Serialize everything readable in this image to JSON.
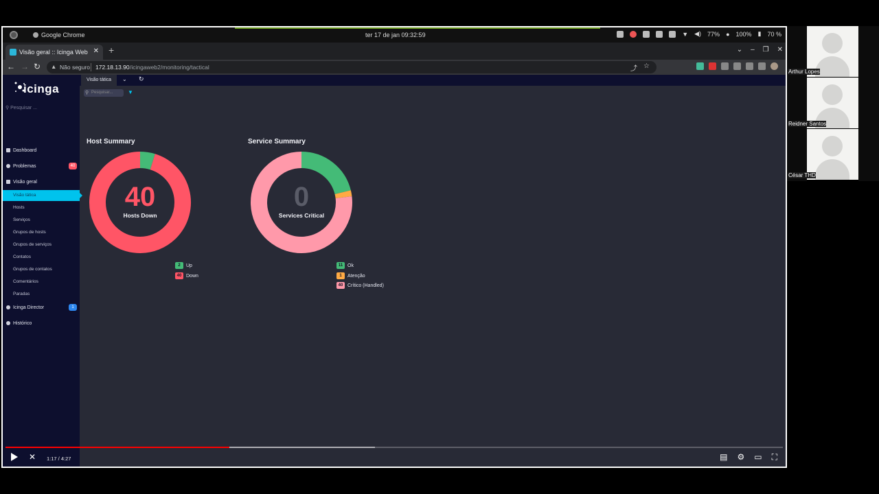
{
  "os_bar": {
    "app_name": "Google Chrome",
    "clock": "ter 17 de jan  09:32:59",
    "wifi": "77%",
    "battery": "100%",
    "extra": "70 %"
  },
  "browser": {
    "tab_title": "Visão geral :: Icinga Web",
    "security_label": "Não seguro",
    "url_host": "172.18.13.90",
    "url_path": "/icingaweb2/monitoring/tactical",
    "hover_url": "172.18.13.90/icingaweb2/monitoring/tactical"
  },
  "icinga": {
    "logo": "icinga",
    "search_placeholder": "Pesquisar ...",
    "nav": {
      "dashboard": "Dashboard",
      "problems": "Problemas",
      "problems_badge": "40",
      "overview": "Visão geral",
      "sub": [
        "Visão tática",
        "Hosts",
        "Serviços",
        "Grupos de hosts",
        "Grupos de serviços",
        "Contatos",
        "Grupos de contatos",
        "Comentários",
        "Paradas"
      ],
      "director": "Icinga Director",
      "director_badge": "1",
      "history": "Histórico"
    },
    "content_tab": "Visão tática",
    "filter_placeholder": "Pesquisar...",
    "host_summary": {
      "title": "Host Summary",
      "big_number": "40",
      "caption": "Hosts Down",
      "legend": [
        {
          "count": "2",
          "label": "Up",
          "value": 2,
          "color": "#44bb77"
        },
        {
          "count": "40",
          "label": "Down",
          "value": 40,
          "color": "#ff5566"
        }
      ]
    },
    "service_summary": {
      "title": "Service Summary",
      "big_number": "0",
      "caption": "Services Critical",
      "legend": [
        {
          "count": "11",
          "label": "Ok",
          "value": 11,
          "color": "#44bb77"
        },
        {
          "count": "1",
          "label": "Atenção",
          "value": 1,
          "color": "#ffaa44"
        },
        {
          "count": "40",
          "label": "Crítico (Handled)",
          "value": 40,
          "color": "#ff99aa"
        }
      ]
    }
  },
  "video": {
    "timecode": "1:17 / 4:27",
    "played_fraction": 0.288,
    "buffered_fraction": 0.475
  },
  "participants": [
    {
      "name": "Arthur Lopes"
    },
    {
      "name": "Reidner Santos"
    },
    {
      "name": "César THD"
    }
  ]
}
